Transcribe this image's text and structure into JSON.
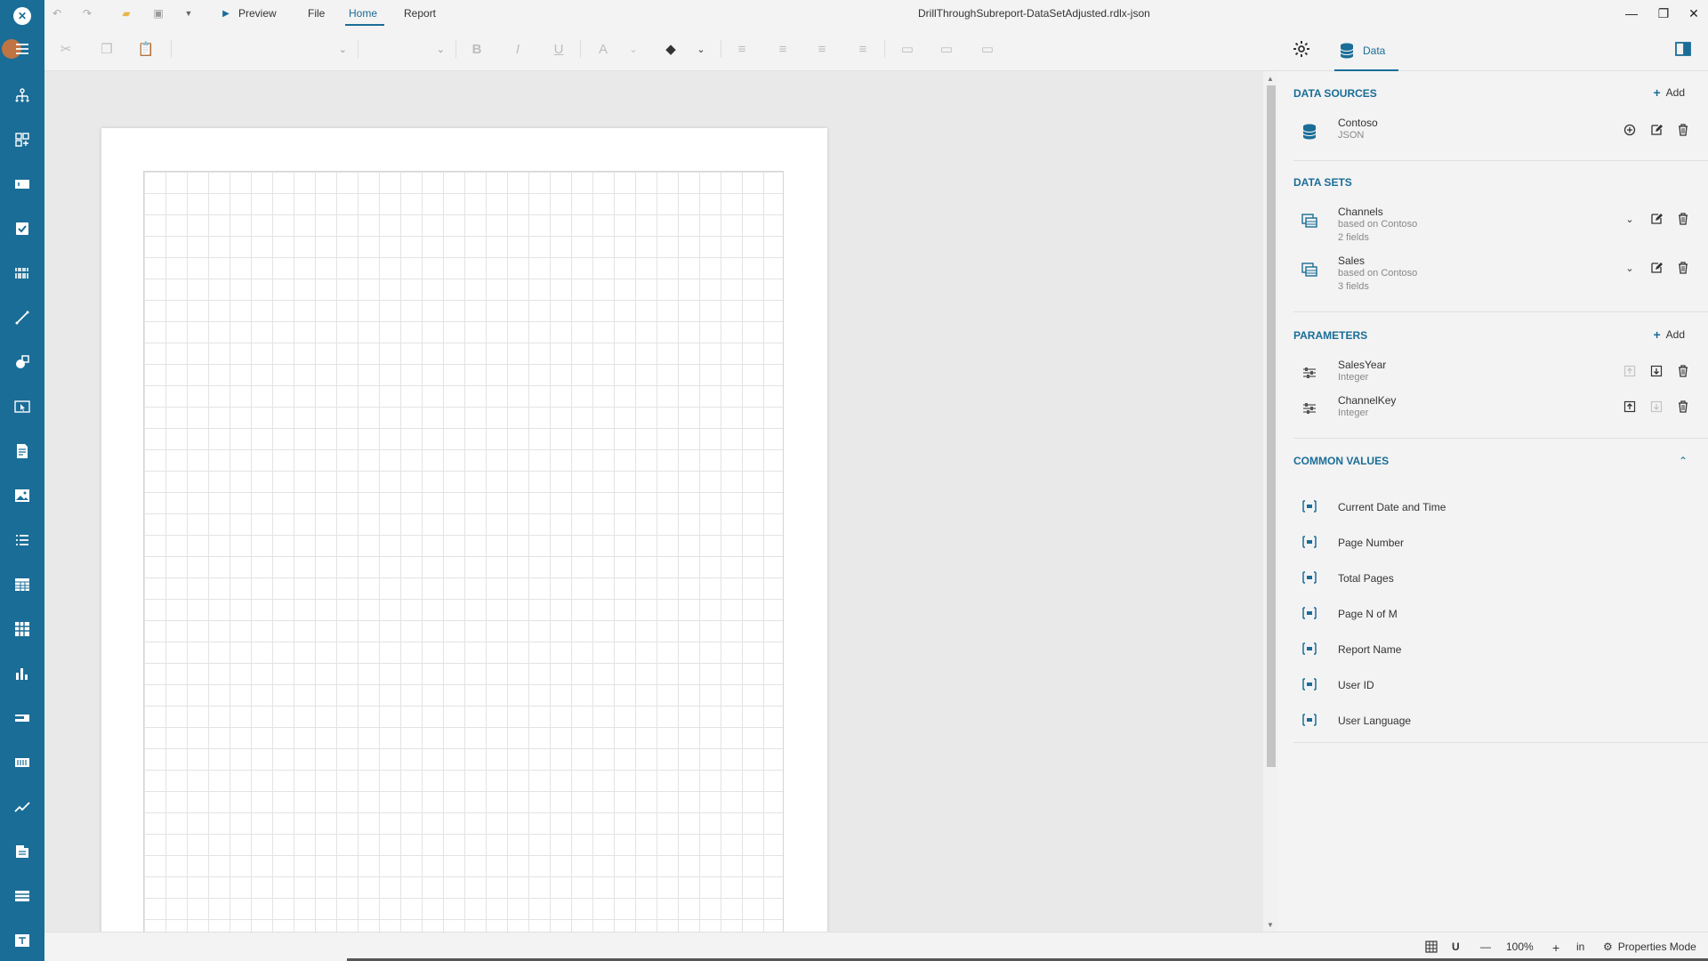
{
  "titlebar": {
    "title": "DrillThroughSubreport-DataSetAdjusted.rdlx-json",
    "preview_label": "Preview",
    "tabs": [
      "File",
      "Home",
      "Report"
    ]
  },
  "panel": {
    "tab_label": "Data",
    "add_label": "Add",
    "data_sources": {
      "heading": "DATA SOURCES",
      "items": [
        {
          "name": "Contoso",
          "type": "JSON"
        }
      ]
    },
    "data_sets": {
      "heading": "DATA SETS",
      "items": [
        {
          "name": "Channels",
          "based_on": "based on Contoso",
          "fields": "2 fields"
        },
        {
          "name": "Sales",
          "based_on": "based on Contoso",
          "fields": "3 fields"
        }
      ]
    },
    "parameters": {
      "heading": "PARAMETERS",
      "items": [
        {
          "name": "SalesYear",
          "type": "Integer"
        },
        {
          "name": "ChannelKey",
          "type": "Integer"
        }
      ]
    },
    "common_values": {
      "heading": "COMMON VALUES",
      "items": [
        "Current Date and Time",
        "Page Number",
        "Total Pages",
        "Page N of M",
        "Report Name",
        "User ID",
        "User Language"
      ]
    }
  },
  "statusbar": {
    "zoom": "100%",
    "units": "in",
    "properties_mode": "Properties Mode"
  },
  "colors": {
    "accent": "#1a6d97",
    "toolbar": "#1a6d97"
  }
}
